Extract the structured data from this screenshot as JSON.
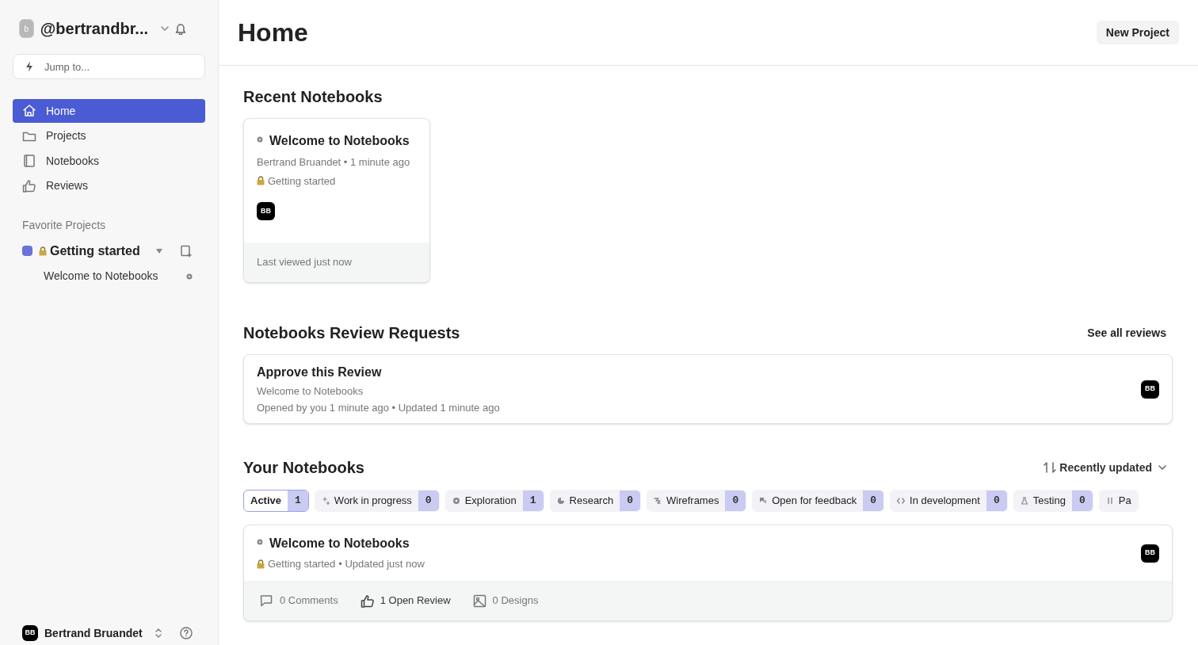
{
  "sidebar": {
    "avatar_letter": "b",
    "username": "@bertrandbr...",
    "search": {
      "placeholder": "Jump to..."
    },
    "nav": [
      {
        "label": "Home",
        "kind": "home",
        "selected": true
      },
      {
        "label": "Projects",
        "kind": "folder",
        "selected": false
      },
      {
        "label": "Notebooks",
        "kind": "notebook",
        "selected": false
      },
      {
        "label": "Reviews",
        "kind": "thumb",
        "selected": false
      }
    ],
    "favorites_heading": "Favorite Projects",
    "favorites": [
      {
        "label": "Getting started",
        "color": "#6b72d9",
        "children": [
          {
            "label": "Welcome to Notebooks"
          }
        ]
      }
    ],
    "user": {
      "initials": "BB",
      "name": "Bertrand Bruandet"
    }
  },
  "header": {
    "title": "Home",
    "button": "New Project"
  },
  "recent": {
    "heading": "Recent Notebooks",
    "cards": [
      {
        "title": "Welcome to Notebooks",
        "meta": "Bertrand Bruandet • 1 minute ago",
        "project": "Getting started",
        "avatar": "BB",
        "footer": "Last viewed just now"
      }
    ]
  },
  "reviews": {
    "heading": "Notebooks Review Requests",
    "link": "See all reviews",
    "items": [
      {
        "title": "Approve this Review",
        "notebook": "Welcome to Notebooks",
        "meta": "Opened by you 1 minute ago • Updated 1 minute ago",
        "avatar": "BB"
      }
    ]
  },
  "your_notebooks": {
    "heading": "Your Notebooks",
    "sort": "Recently updated",
    "filters": [
      {
        "label": "Active",
        "count": "1",
        "kind": "none",
        "selected": true
      },
      {
        "label": "Work in progress",
        "count": "0",
        "kind": "sparkle",
        "selected": false
      },
      {
        "label": "Exploration",
        "count": "1",
        "kind": "dot",
        "selected": false
      },
      {
        "label": "Research",
        "count": "0",
        "kind": "pie",
        "selected": false
      },
      {
        "label": "Wireframes",
        "count": "0",
        "kind": "wire",
        "selected": false
      },
      {
        "label": "Open for feedback",
        "count": "0",
        "kind": "chat",
        "selected": false
      },
      {
        "label": "In development",
        "count": "0",
        "kind": "code",
        "selected": false
      },
      {
        "label": "Testing",
        "count": "0",
        "kind": "flask",
        "selected": false
      },
      {
        "label": "Pa",
        "kind": "pause",
        "selected": false
      }
    ],
    "items": [
      {
        "title": "Welcome to Notebooks",
        "project": "Getting started",
        "meta": "• Updated just now",
        "avatar": "BB",
        "comments": "0 Comments",
        "open_reviews": "1 Open Review",
        "designs": "0 Designs"
      }
    ]
  }
}
